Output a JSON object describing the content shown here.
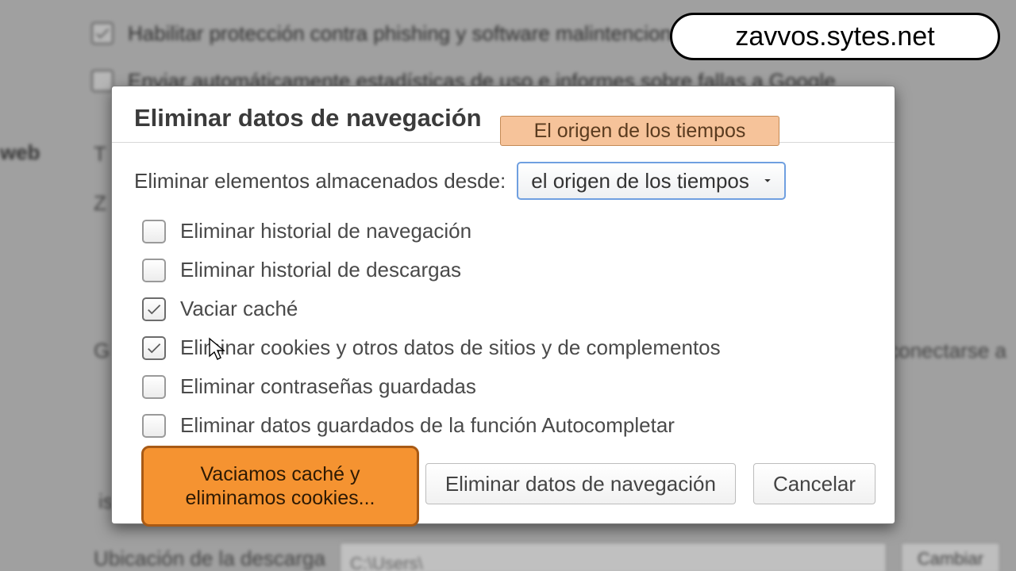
{
  "url_callout": "zavvos.sytes.net",
  "background": {
    "opt1": "Habilitar protección contra phishing y software malintencionado",
    "opt2": "Enviar automáticamente estadísticas de uso e informes sobre fallas a Google",
    "web_label": "web",
    "t_line": "T",
    "z_line": "Z",
    "g_line": "G",
    "conn_fragment": "ra conectarse a",
    "is_line": "is",
    "download_label": "Ubicación de la descarga",
    "download_path": "C:\\Users\\",
    "download_btn": "Cambiar"
  },
  "dialog": {
    "title": "Eliminar datos de navegación",
    "since_label": "Eliminar elementos almacenados desde:",
    "since_value": "el origen de los tiempos",
    "options": [
      {
        "label": "Eliminar historial de navegación",
        "checked": false
      },
      {
        "label": "Eliminar historial de descargas",
        "checked": false
      },
      {
        "label": "Vaciar caché",
        "checked": true
      },
      {
        "label": "Eliminar cookies y otros datos de sitios y de complementos",
        "checked": true
      },
      {
        "label": "Eliminar contraseñas guardadas",
        "checked": false
      },
      {
        "label": "Eliminar datos guardados de la función Autocompletar",
        "checked": false
      }
    ],
    "confirm": "Eliminar datos de navegación",
    "cancel": "Cancelar"
  },
  "hints": {
    "top": "El origen de los tiempos",
    "bottom": "Vaciamos caché y eliminamos cookies..."
  }
}
